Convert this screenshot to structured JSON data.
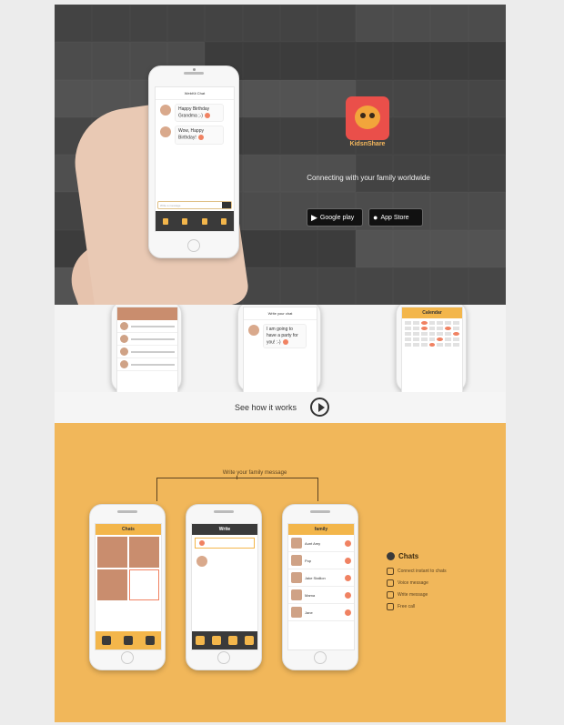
{
  "hero": {
    "chat_title": "WebKit Chat",
    "messages": [
      "Happy Birthday Grandma ;-)",
      "Wow, Happy Birthday!"
    ],
    "input_placeholder": "Write a message",
    "brand_name": "KidsnShare",
    "tagline": "Connecting with your family worldwide",
    "store_google": "Google play",
    "store_apple": "App Store"
  },
  "strip": {
    "chat_phone_title": "Write your chat",
    "chat_phone_message": "I am going to have a party for you! :-)",
    "calendar_phone_title": "Calendar"
  },
  "how": {
    "label": "See how it works"
  },
  "feature": {
    "write_label": "Write your family message",
    "phone1_title": "Chats",
    "phone2_title": "Write",
    "phone3_title": "family",
    "family_names": [
      "Aunt Amy",
      "Pop",
      "Jake Stallion",
      "Mama",
      "Jane"
    ],
    "legend_title": "Chats",
    "legend_items": [
      "Connect instant to chats",
      "Voice message",
      "Write message",
      "Free call"
    ]
  },
  "colors": {
    "accent": "#f1b75a",
    "brand": "#ea4f4a",
    "highlight": "#f08262"
  }
}
